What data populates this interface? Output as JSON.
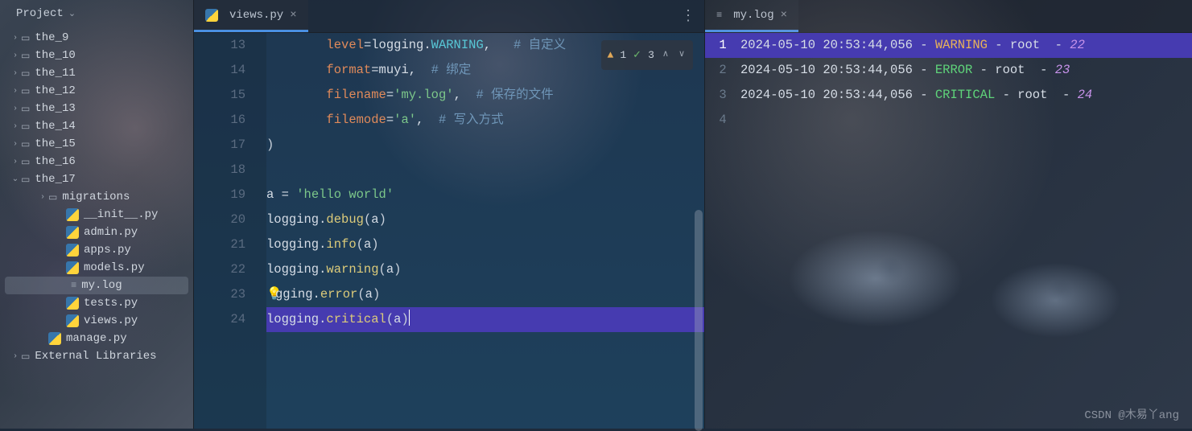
{
  "sidebar": {
    "title": "Project",
    "items": [
      {
        "indent": 12,
        "arrow": "›",
        "icon": "folder",
        "label": "the_9"
      },
      {
        "indent": 12,
        "arrow": "›",
        "icon": "folder",
        "label": "the_10"
      },
      {
        "indent": 12,
        "arrow": "›",
        "icon": "folder",
        "label": "the_11"
      },
      {
        "indent": 12,
        "arrow": "›",
        "icon": "folder",
        "label": "the_12"
      },
      {
        "indent": 12,
        "arrow": "›",
        "icon": "folder",
        "label": "the_13"
      },
      {
        "indent": 12,
        "arrow": "›",
        "icon": "folder",
        "label": "the_14"
      },
      {
        "indent": 12,
        "arrow": "›",
        "icon": "folder",
        "label": "the_15"
      },
      {
        "indent": 12,
        "arrow": "›",
        "icon": "folder",
        "label": "the_16"
      },
      {
        "indent": 12,
        "arrow": "⌄",
        "icon": "folder",
        "label": "the_17"
      },
      {
        "indent": 46,
        "arrow": "›",
        "icon": "folder",
        "label": "migrations"
      },
      {
        "indent": 68,
        "arrow": "",
        "icon": "py",
        "label": "__init__.py"
      },
      {
        "indent": 68,
        "arrow": "",
        "icon": "py",
        "label": "admin.py"
      },
      {
        "indent": 68,
        "arrow": "",
        "icon": "py",
        "label": "apps.py"
      },
      {
        "indent": 68,
        "arrow": "",
        "icon": "py",
        "label": "models.py"
      },
      {
        "indent": 68,
        "arrow": "",
        "icon": "log",
        "label": "my.log",
        "selected": true
      },
      {
        "indent": 68,
        "arrow": "",
        "icon": "py",
        "label": "tests.py"
      },
      {
        "indent": 68,
        "arrow": "",
        "icon": "py",
        "label": "views.py"
      },
      {
        "indent": 46,
        "arrow": "",
        "icon": "py",
        "label": "manage.py"
      },
      {
        "indent": 12,
        "arrow": "›",
        "icon": "folder",
        "label": "External Libraries"
      }
    ]
  },
  "tabs": {
    "left": {
      "label": "views.py"
    },
    "right": {
      "label": "my.log"
    }
  },
  "inspector": {
    "warn_count": "1",
    "check_count": "3"
  },
  "code": {
    "lines": [
      {
        "n": "13",
        "pad": "        ",
        "k": "level",
        "eq": "=logging.WARNING,   ",
        "c": "# 自定义"
      },
      {
        "n": "14",
        "pad": "        ",
        "k": "format",
        "eq": "=muyi,  ",
        "c": "# 绑定"
      },
      {
        "n": "15",
        "pad": "        ",
        "k": "filename",
        "eq": "=",
        "s": "'my.log'",
        "tail": ",  ",
        "c": "# 保存的文件"
      },
      {
        "n": "16",
        "pad": "        ",
        "k": "filemode",
        "eq": "=",
        "s": "'a'",
        "tail": ",  ",
        "c": "# 写入方式"
      },
      {
        "n": "17",
        "raw": ")"
      },
      {
        "n": "18",
        "raw": ""
      },
      {
        "n": "19",
        "assign": "a = ",
        "s": "'hello world'"
      },
      {
        "n": "20",
        "call": "logging.debug(a)"
      },
      {
        "n": "21",
        "call": "logging.info(a)"
      },
      {
        "n": "22",
        "call": "logging.warning(a)"
      },
      {
        "n": "23",
        "bulb": true,
        "call": "logging.error(a)"
      },
      {
        "n": "24",
        "current": true,
        "call": "logging.critical(a)"
      }
    ]
  },
  "log": {
    "lines": [
      {
        "n": "1",
        "hl": true,
        "ts": "2024-05-10 20:53:44,056",
        "lvl": "WARNING",
        "lvlClass": "lvl-warn",
        "name": "root",
        "line": "22"
      },
      {
        "n": "2",
        "ts": "2024-05-10 20:53:44,056",
        "lvl": "ERROR",
        "lvlClass": "lvl-err",
        "name": "root",
        "line": "23"
      },
      {
        "n": "3",
        "ts": "2024-05-10 20:53:44,056",
        "lvl": "CRITICAL",
        "lvlClass": "lvl-crit",
        "name": "root",
        "line": "24"
      },
      {
        "n": "4",
        "empty": true
      }
    ]
  },
  "watermark": "CSDN @木易丫ang"
}
